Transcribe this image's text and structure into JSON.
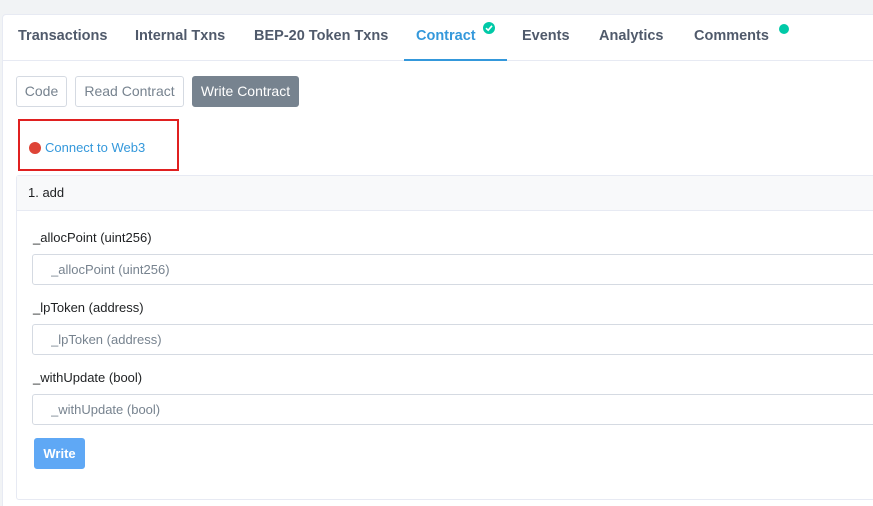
{
  "tabs": [
    {
      "label": "Transactions"
    },
    {
      "label": "Internal Txns"
    },
    {
      "label": "BEP-20 Token Txns"
    },
    {
      "label": "Contract",
      "verified_icon": "check-circle-icon",
      "active": true
    },
    {
      "label": "Events"
    },
    {
      "label": "Analytics"
    },
    {
      "label": "Comments",
      "badge_icon": "notification-dot-icon"
    }
  ],
  "subnav": {
    "code": "Code",
    "read_contract": "Read Contract",
    "write_contract": "Write Contract"
  },
  "connect": {
    "label": "Connect to Web3",
    "status_color": "#de4437"
  },
  "function": {
    "title": "1. add",
    "params": [
      {
        "label": "_allocPoint (uint256)",
        "placeholder": "_allocPoint (uint256)"
      },
      {
        "label": "_lpToken (address)",
        "placeholder": "_lpToken (address)"
      },
      {
        "label": "_withUpdate (bool)",
        "placeholder": "_withUpdate (bool)"
      }
    ],
    "write_label": "Write"
  },
  "colors": {
    "accent": "#3498db",
    "success": "#00c9a7",
    "highlight": "#e02020",
    "write_button": "#5fa8f5"
  }
}
